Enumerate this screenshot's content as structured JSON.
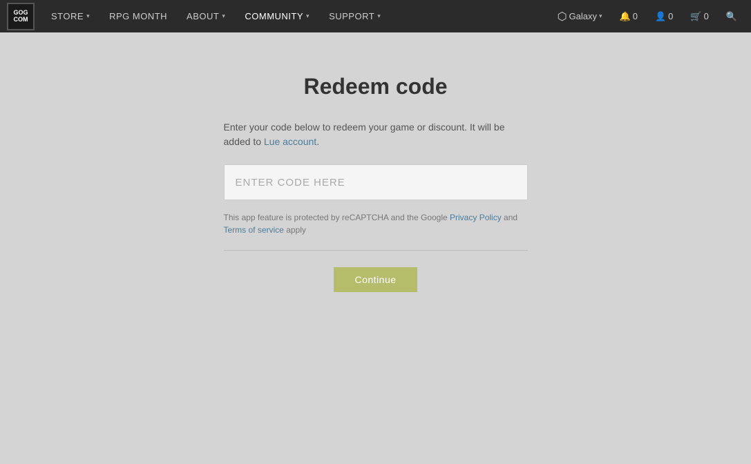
{
  "nav": {
    "logo_line1": "GOG",
    "logo_line2": "COM",
    "items": [
      {
        "label": "STORE",
        "has_chevron": true
      },
      {
        "label": "RPG MONTH",
        "has_chevron": false
      },
      {
        "label": "ABOUT",
        "has_chevron": true
      },
      {
        "label": "COMMUNITY",
        "has_chevron": true
      },
      {
        "label": "SUPPORT",
        "has_chevron": true
      }
    ],
    "right_items": [
      {
        "icon": "🔔",
        "count": "0",
        "name": "notifications"
      },
      {
        "icon": "👤",
        "count": "0",
        "name": "account"
      },
      {
        "icon": "🛒",
        "count": "0",
        "name": "cart"
      }
    ],
    "galaxy_label": "Galaxy",
    "search_icon": "🔍"
  },
  "page": {
    "title": "Redeem code",
    "description_part1": "Enter your code below to redeem your game or discount. It will be added to Lue account.",
    "description_account": "Lue account",
    "code_input_placeholder": "ENTER CODE HERE",
    "recaptcha_part1": "This app feature is protected by reCAPTCHA and the Google ",
    "privacy_policy_label": "Privacy Policy",
    "and_text": " and ",
    "terms_label": "Terms of service",
    "apply_text": " apply",
    "continue_button": "Continue"
  }
}
